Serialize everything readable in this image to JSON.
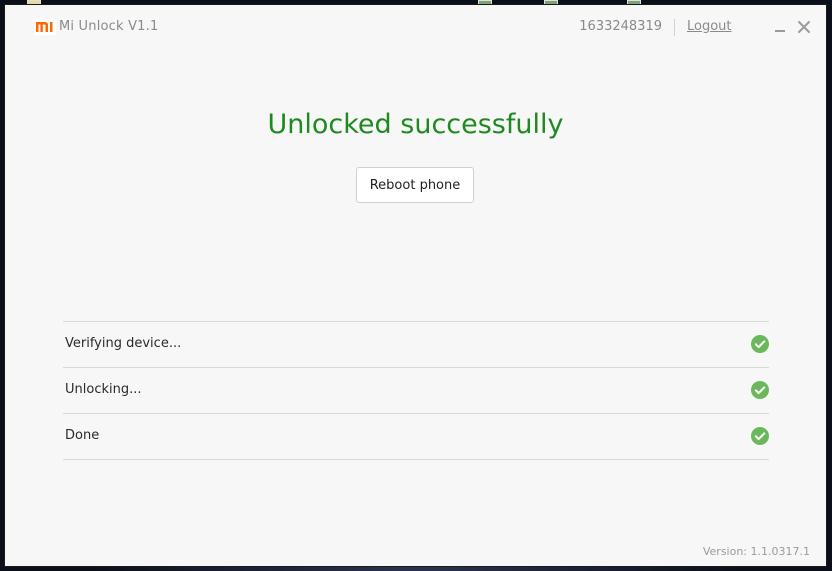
{
  "app": {
    "logo_text": "mi",
    "title": "Mi Unlock  V1.1",
    "brand_color": "#ff6700"
  },
  "account": {
    "id": "1633248319",
    "logout_label": "Logout"
  },
  "window_controls": {
    "minimize_icon": "minimize-icon",
    "close_icon": "close-icon"
  },
  "main": {
    "headline": "Unlocked successfully",
    "headline_color": "#1f8a1f",
    "reboot_label": "Reboot phone"
  },
  "steps": [
    {
      "label": "Verifying device...",
      "status": "done",
      "icon": "check-circle-icon"
    },
    {
      "label": "Unlocking...",
      "status": "done",
      "icon": "check-circle-icon"
    },
    {
      "label": "Done",
      "status": "done",
      "icon": "check-circle-icon"
    }
  ],
  "check_color": "#6bb85c",
  "footer": {
    "version": "Version: 1.1.0317.1"
  }
}
